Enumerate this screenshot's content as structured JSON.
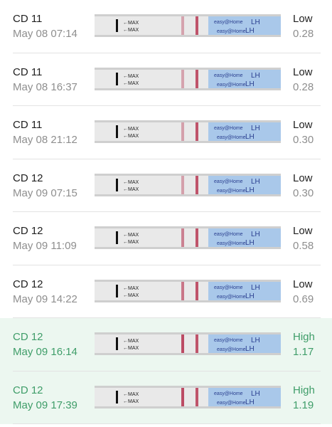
{
  "colors": {
    "low_text": "#1f1f1f",
    "secondary_text": "#8e8e8e",
    "high_text": "#3f9d69",
    "high_row_bg": "#ecf7f0",
    "strip_body": "#e9e9e9",
    "test_line": "#b73a55",
    "brand_blue": "#a9c8ea"
  },
  "strip_labels": {
    "max_upper": "←MAX",
    "max_lower": "←MAX",
    "brand": "easy@Home",
    "lh": "LH"
  },
  "readings": [
    {
      "cycle_day": "CD 11",
      "datetime": "May 08 07:14",
      "result": "Low",
      "ratio": "0.28",
      "high": false,
      "icons": [
        "test-strip-photo"
      ]
    },
    {
      "cycle_day": "CD 11",
      "datetime": "May 08 16:37",
      "result": "Low",
      "ratio": "0.28",
      "high": false,
      "icons": [
        "test-strip-photo"
      ]
    },
    {
      "cycle_day": "CD 11",
      "datetime": "May 08 21:12",
      "result": "Low",
      "ratio": "0.30",
      "high": false,
      "icons": [
        "test-strip-photo"
      ]
    },
    {
      "cycle_day": "CD 12",
      "datetime": "May 09 07:15",
      "result": "Low",
      "ratio": "0.30",
      "high": false,
      "icons": [
        "test-strip-photo"
      ]
    },
    {
      "cycle_day": "CD 12",
      "datetime": "May 09 11:09",
      "result": "Low",
      "ratio": "0.58",
      "high": false,
      "icons": [
        "test-strip-photo"
      ]
    },
    {
      "cycle_day": "CD 12",
      "datetime": "May 09 14:22",
      "result": "Low",
      "ratio": "0.69",
      "high": false,
      "icons": [
        "test-strip-photo"
      ]
    },
    {
      "cycle_day": "CD 12",
      "datetime": "May 09 16:14",
      "result": "High",
      "ratio": "1.17",
      "high": true,
      "icons": [
        "test-strip-photo"
      ]
    },
    {
      "cycle_day": "CD 12",
      "datetime": "May 09 17:39",
      "result": "High",
      "ratio": "1.19",
      "high": true,
      "icons": [
        "test-strip-photo"
      ]
    }
  ]
}
